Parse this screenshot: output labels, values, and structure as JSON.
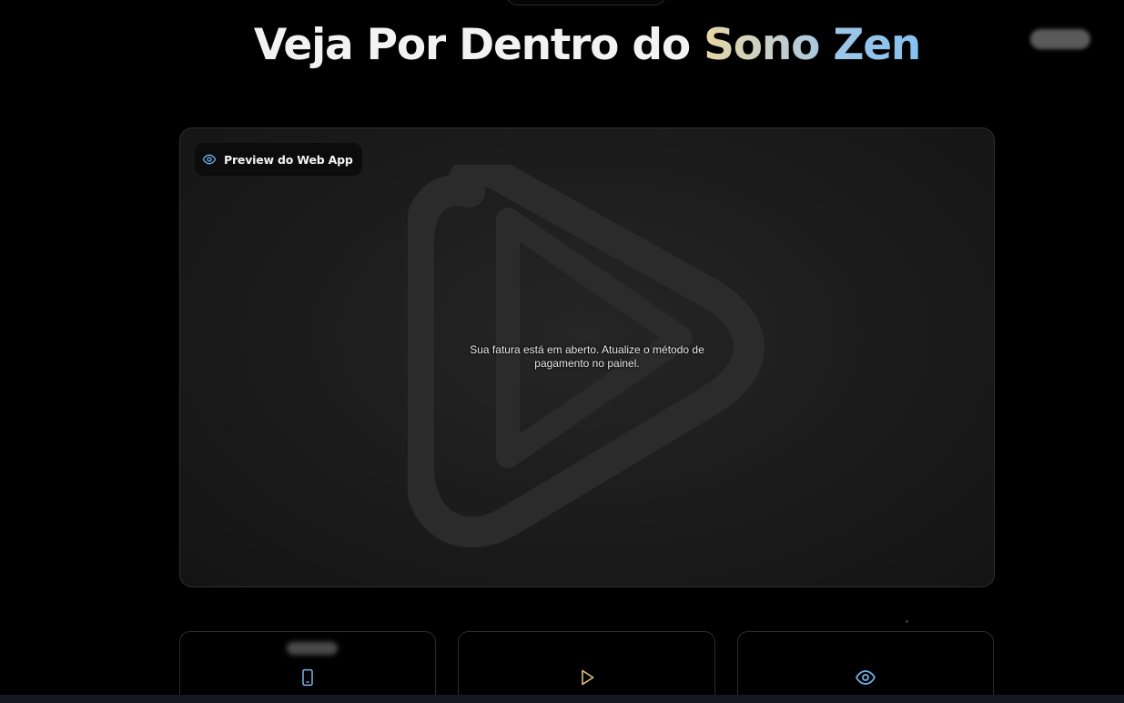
{
  "header": {
    "title_prefix": "Veja Por Dentro do ",
    "title_highlight": "Sono Zen"
  },
  "preview": {
    "badge_icon": "eye-icon",
    "badge_label": "Preview do Web App",
    "watermark_icon": "play-icon",
    "notice_line1": "Sua fatura está em aberto. Atualize o método de",
    "notice_line2": "pagamento no painel."
  },
  "features": [
    {
      "icon": "smartphone-icon",
      "color": "#7fb6e8"
    },
    {
      "icon": "play-icon",
      "color": "#e6c97a"
    },
    {
      "icon": "eye-icon",
      "color": "#6fb2ec"
    }
  ],
  "colors": {
    "background": "#000000",
    "card_border": "#2f2f2f",
    "accent_blue": "#6fb2ec",
    "accent_gold": "#e6c97a"
  }
}
